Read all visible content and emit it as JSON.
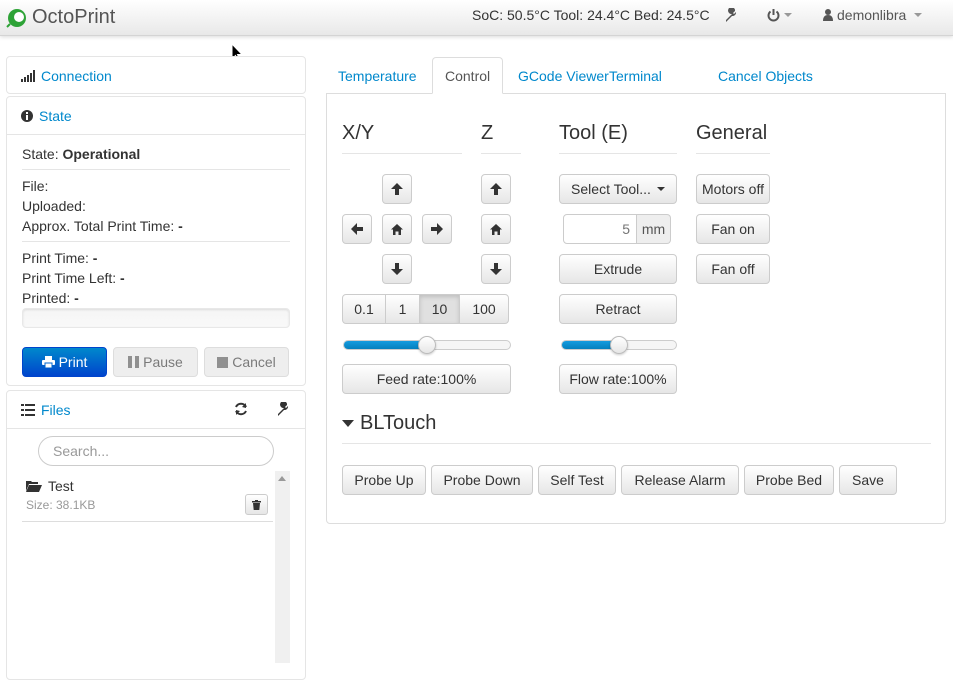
{
  "navbar": {
    "brand": "OctoPrint",
    "temperatures": "SoC: 50.5°C Tool: 24.4°C Bed: 24.5°C",
    "user": "demonlibra",
    "icons": [
      "octoprint-logo-icon",
      "wrench-icon",
      "power-icon",
      "user-icon"
    ]
  },
  "sidebar": {
    "connection": {
      "title": "Connection"
    },
    "state": {
      "title": "State",
      "state_label": "State:",
      "state_value": "Operational",
      "file_label": "File:",
      "uploaded_label": "Uploaded:",
      "total_time_label": "Approx. Total Print Time:",
      "total_time_value": "-",
      "print_time_label": "Print Time:",
      "print_time_value": "-",
      "time_left_label": "Print Time Left:",
      "time_left_value": "-",
      "printed_label": "Printed:",
      "printed_value": "-",
      "progress_percent": 0,
      "print_button": "Print",
      "pause_button": "Pause",
      "cancel_button": "Cancel"
    },
    "files": {
      "title": "Files",
      "search_placeholder": "Search...",
      "items": [
        {
          "name": "Test",
          "size": "Size: 38.1KB"
        }
      ]
    }
  },
  "tabs": [
    {
      "label": "Temperature"
    },
    {
      "label": "Control",
      "active": true
    },
    {
      "label": "GCode Viewer"
    },
    {
      "label": "Terminal"
    },
    {
      "label": "Cancel Objects"
    }
  ],
  "control": {
    "xy_title": "X/Y",
    "z_title": "Z",
    "tool_title": "Tool (E)",
    "general_title": "General",
    "step_options": [
      "0.1",
      "1",
      "10",
      "100"
    ],
    "step_selected": "10",
    "feed_rate_label": "Feed rate:100%",
    "feed_rate_percent": 100,
    "feed_slider_fraction": 0.5,
    "select_tool_label": "Select Tool...",
    "extrude_amount": "5",
    "extrude_unit": "mm",
    "extrude_label": "Extrude",
    "retract_label": "Retract",
    "flow_rate_label": "Flow rate:100%",
    "flow_rate_percent": 100,
    "flow_slider_fraction": 0.5,
    "motors_off_label": "Motors off",
    "fan_on_label": "Fan on",
    "fan_off_label": "Fan off",
    "bltouch_title": "BLTouch",
    "bltouch_buttons": [
      "Probe Up",
      "Probe Down",
      "Self Test",
      "Release Alarm",
      "Probe Bed",
      "Save"
    ]
  },
  "colors": {
    "link": "#0088cc",
    "primary": "#0044cc",
    "brand_green": "#2ea337",
    "slider_fill": "#0480be"
  }
}
